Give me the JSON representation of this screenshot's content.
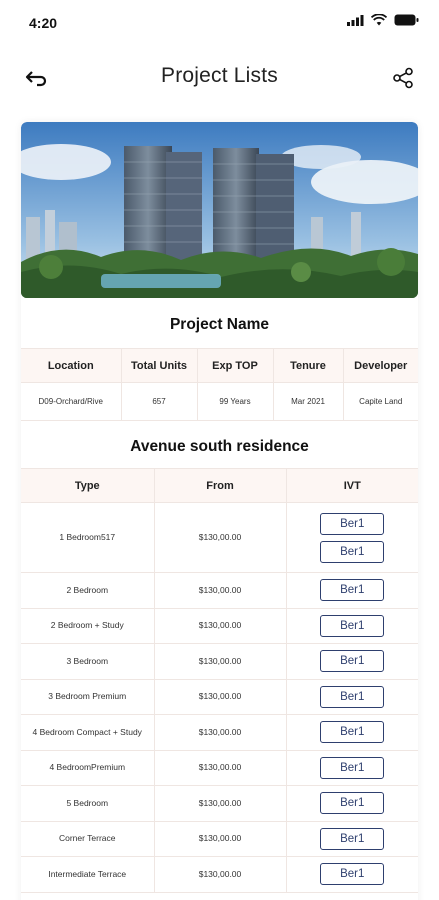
{
  "status_bar": {
    "time": "4:20"
  },
  "nav": {
    "title": "Project Lists"
  },
  "project": {
    "title": "Project Name",
    "headers": [
      "Location",
      "Total Units",
      "Exp TOP",
      "Tenure",
      "Developer"
    ],
    "values": [
      "D09-Orchard/Rive",
      "657",
      "99 Years",
      "Mar 2021",
      "Capite Land"
    ]
  },
  "residence": {
    "title": "Avenue south residence",
    "headers": [
      "Type",
      "From",
      "IVT"
    ],
    "button_label": "Ber1",
    "rows": [
      {
        "type": "1 Bedroom517",
        "from": "$130,00.00"
      },
      {
        "type": "2 Bedroom",
        "from": "$130,00.00"
      },
      {
        "type": "2 Bedroom + Study",
        "from": "$130,00.00"
      },
      {
        "type": "3 Bedroom",
        "from": "$130,00.00"
      },
      {
        "type": "3 Bedroom Premium",
        "from": "$130,00.00"
      },
      {
        "type": "4 Bedroom Compact + Study",
        "from": "$130,00.00"
      },
      {
        "type": "4 BedroomPremium",
        "from": "$130,00.00"
      },
      {
        "type": "5 Bedroom",
        "from": "$130,00.00"
      },
      {
        "type": "Corner Terrace",
        "from": "$130,00.00"
      },
      {
        "type": "Intermediate Terrace",
        "from": "$130,00.00"
      }
    ]
  },
  "colors": {
    "accent": "#2e3f6e",
    "header_bg": "#fdf6f3"
  }
}
